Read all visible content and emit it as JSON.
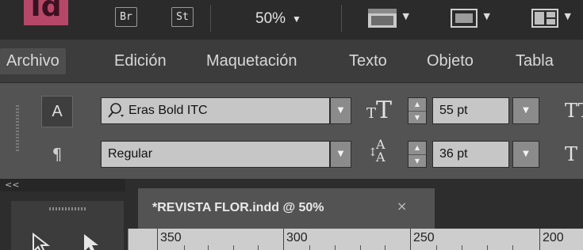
{
  "app": {
    "logo": "Id",
    "bridge_label": "Br",
    "stock_label": "St",
    "zoom": "50%",
    "zoom_arrow": "▼",
    "view_icon": "screen-mode-icon",
    "frame_icon": "frame-icon",
    "arrange_icon": "arrange-documents-icon"
  },
  "menu": {
    "items": [
      {
        "label": "Archivo"
      },
      {
        "label": "Edición"
      },
      {
        "label": "Maquetación"
      },
      {
        "label": "Texto"
      },
      {
        "label": "Objeto"
      },
      {
        "label": "Tabla"
      }
    ]
  },
  "control": {
    "char_mode": "A",
    "para_mode": "¶",
    "font_family": "Eras Bold ITC",
    "font_style": "Regular",
    "font_size": "55 pt",
    "leading": "36 pt",
    "dropdown_arrow": "▼",
    "spin_up": "▲",
    "spin_down": "▼",
    "size_glyph": "T",
    "leading_glyph": "A"
  },
  "panel": {
    "collapse_label": "<<"
  },
  "document": {
    "tab_title": "*REVISTA FLOR.indd @ 50%",
    "close": "×"
  },
  "ruler": {
    "labels": [
      "350",
      "300",
      "250",
      "200"
    ]
  }
}
